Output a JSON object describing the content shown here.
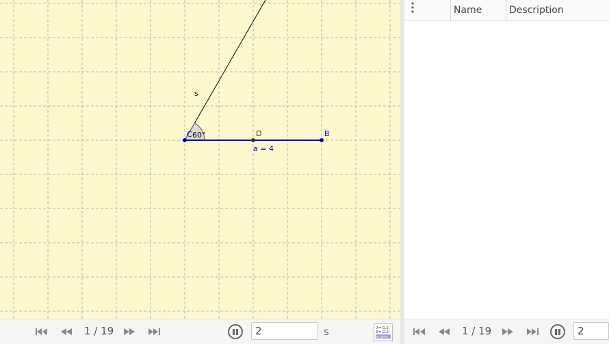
{
  "graphics": {
    "background": "#fdf8cc",
    "grid_color": "#b4b4b4",
    "segment_color": "#0000cc",
    "angle_fill": "#d3d3d3",
    "labels": {
      "ray": "s",
      "C": "C",
      "angle": "60°",
      "D": "D",
      "B": "B",
      "segment": "a = 4"
    }
  },
  "table": {
    "columns": [
      "Name",
      "Description"
    ],
    "menu_icon": "more-vert-icon"
  },
  "navigation_left": {
    "counter": "1 / 19",
    "speed_value": "2",
    "unit": "s",
    "icons": [
      "skip-first-icon",
      "step-back-icon",
      "step-forward-icon",
      "skip-last-icon",
      "pause-icon",
      "algebra-icon"
    ],
    "algebra_icon_lines": [
      "A=(1,1)",
      "B=(2,2)",
      "c: y=x"
    ]
  },
  "navigation_right": {
    "counter": "1 / 19",
    "speed_value": "2"
  }
}
